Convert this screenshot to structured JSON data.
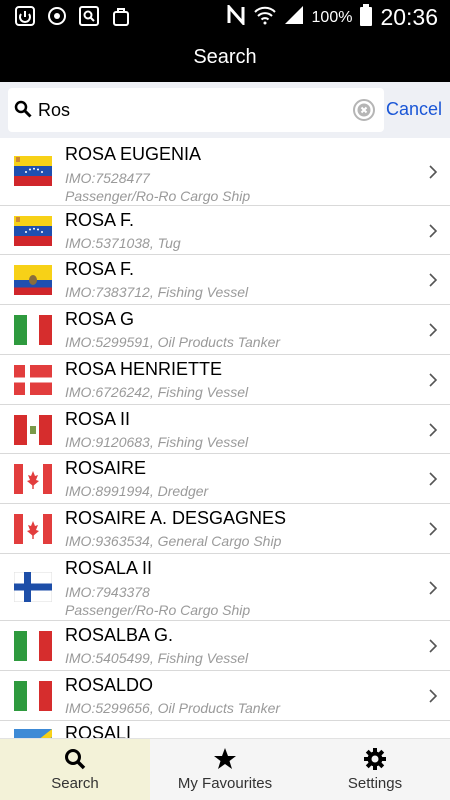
{
  "status_bar": {
    "battery": "100%",
    "time": "20:36",
    "icons": [
      "screen-mirror-icon",
      "sync-icon",
      "search-app-icon",
      "bag-icon",
      "nfc-icon",
      "wifi-icon",
      "signal-icon",
      "battery-icon"
    ]
  },
  "header": {
    "title": "Search"
  },
  "search": {
    "value": "Ros",
    "cancel_label": "Cancel"
  },
  "results": [
    {
      "name": "ROSA EUGENIA",
      "line1": "IMO:7528477",
      "line2": "Passenger/Ro-Ro Cargo Ship",
      "flag": "venezuela"
    },
    {
      "name": "ROSA F.",
      "line1": "IMO:5371038, Tug",
      "flag": "venezuela"
    },
    {
      "name": "ROSA F.",
      "line1": "IMO:7383712, Fishing Vessel",
      "flag": "ecuador"
    },
    {
      "name": "ROSA G",
      "line1": "IMO:5299591, Oil Products Tanker",
      "flag": "italy"
    },
    {
      "name": "ROSA HENRIETTE",
      "line1": "IMO:6726242, Fishing Vessel",
      "flag": "denmark"
    },
    {
      "name": "ROSA II",
      "line1": "IMO:9120683, Fishing Vessel",
      "flag": "peru"
    },
    {
      "name": "ROSAIRE",
      "line1": "IMO:8991994, Dredger",
      "flag": "canada"
    },
    {
      "name": "ROSAIRE A. DESGAGNES",
      "line1": "IMO:9363534, General Cargo Ship",
      "flag": "canada"
    },
    {
      "name": "ROSALA II",
      "line1": "IMO:7943378",
      "line2": "Passenger/Ro-Ro Cargo Ship",
      "flag": "finland"
    },
    {
      "name": "ROSALBA G.",
      "line1": "IMO:5405499, Fishing Vessel",
      "flag": "italy"
    },
    {
      "name": "ROSALDO",
      "line1": "IMO:5299656, Oil Products Tanker",
      "flag": "italy"
    },
    {
      "name": "ROSALI",
      "line1": "",
      "flag": "unknown"
    }
  ],
  "tabs": [
    {
      "label": "Search",
      "icon": "search-icon",
      "active": true
    },
    {
      "label": "My Favourites",
      "icon": "star-icon",
      "active": false
    },
    {
      "label": "Settings",
      "icon": "gear-icon",
      "active": false
    }
  ],
  "colors": {
    "accent": "#1a56d6",
    "active_tab": "#f3f2d8",
    "subtitle": "#9a9a9a"
  }
}
